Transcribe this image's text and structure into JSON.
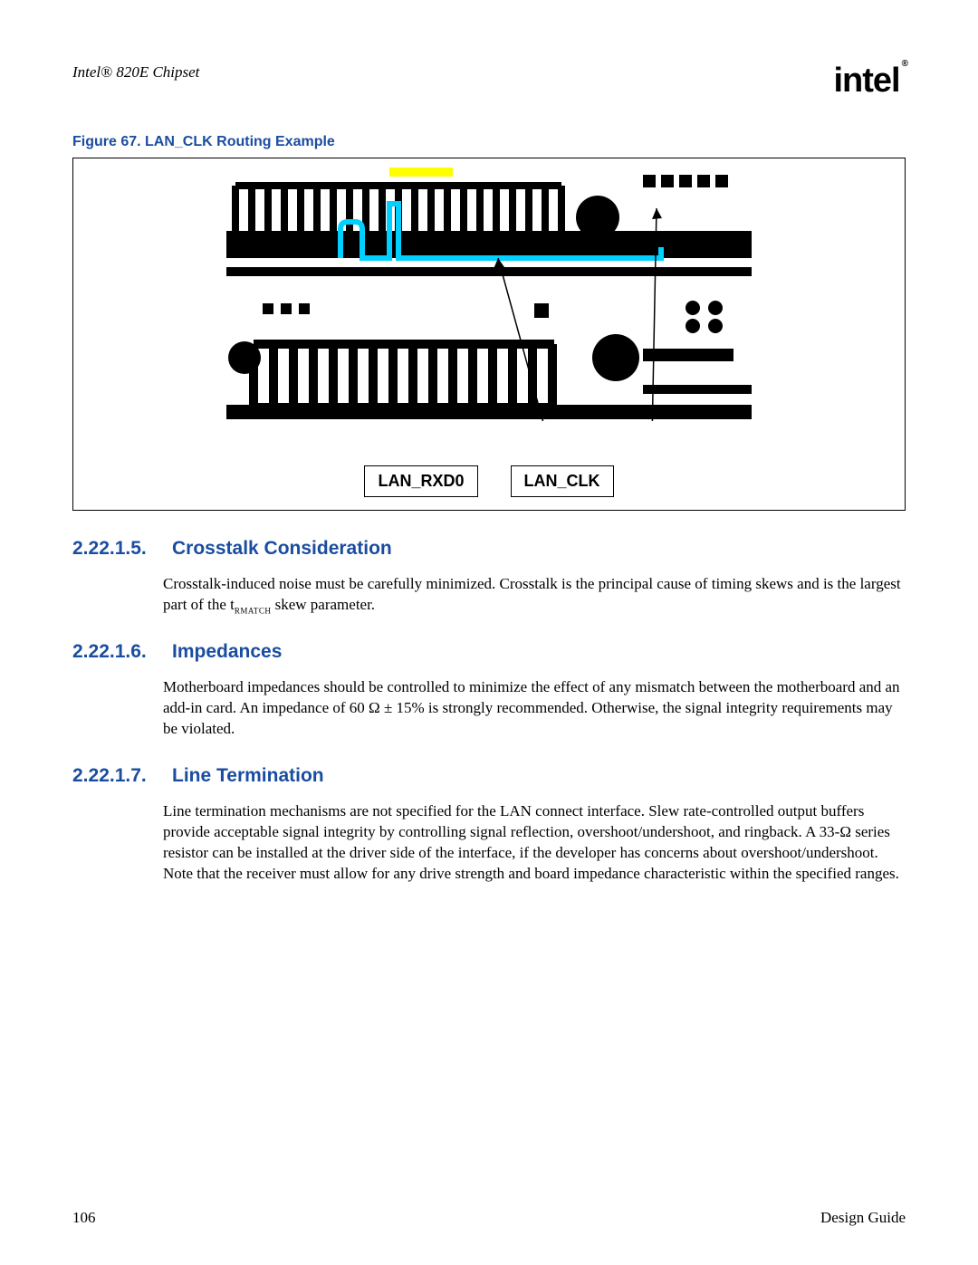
{
  "header": {
    "doc_title": "Intel® 820E Chipset",
    "logo_text": "intel",
    "logo_sub": "®"
  },
  "figure": {
    "caption": "Figure 67. LAN_CLK Routing Example",
    "label_left": "LAN_RXD0",
    "label_right": "LAN_CLK"
  },
  "sections": [
    {
      "num": "2.22.1.5.",
      "title": "Crosstalk Consideration",
      "body": "Crosstalk-induced noise must be carefully minimized. Crosstalk is the principal cause of timing skews and is the largest part of the tRMATCH skew parameter."
    },
    {
      "num": "2.22.1.6.",
      "title": "Impedances",
      "body": "Motherboard impedances should be controlled to minimize the effect of any mismatch between the motherboard and an add-in card. An impedance of 60 Ω ± 15% is strongly recommended. Otherwise, the signal integrity requirements may be violated."
    },
    {
      "num": "2.22.1.7.",
      "title": "Line Termination",
      "body": "Line termination mechanisms are not specified for the LAN connect interface. Slew rate-controlled output buffers provide acceptable signal integrity by controlling signal reflection, overshoot/undershoot, and ringback. A 33-Ω series resistor can be installed at the driver side of the interface, if the developer has concerns about overshoot/undershoot. Note that the receiver must allow for any drive strength and board impedance characteristic within the specified ranges."
    }
  ],
  "footer": {
    "page": "106",
    "label": "Design Guide"
  }
}
